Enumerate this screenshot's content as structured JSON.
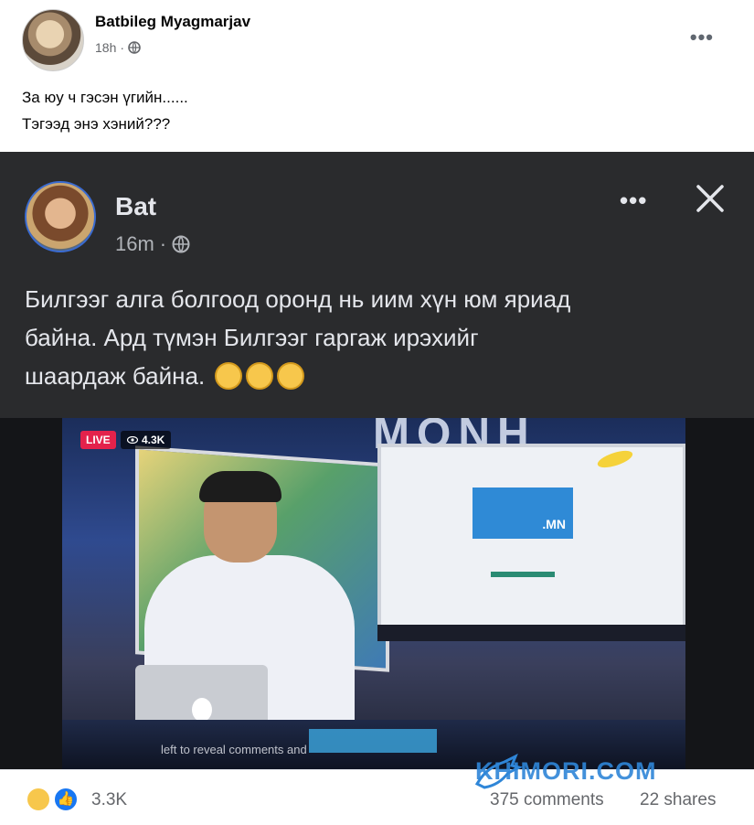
{
  "outer_post": {
    "author": "Batbileg Myagmarjav",
    "time": "18h",
    "privacy_separator": "·",
    "caption_lines": [
      "За юу ч гэсэн үгийн......",
      "Тэгээд энэ хэний???"
    ]
  },
  "shared_post": {
    "author": "Bat",
    "time": "16m",
    "privacy_separator": "·",
    "text_lines": [
      "Билгээг алга болгоод оронд нь иим хүн юм яриад",
      "байна. Ард түмэн Билгээг гаргаж ирэхийг",
      "шаардаж байна."
    ],
    "emoji_count": 3
  },
  "video": {
    "live_label": "LIVE",
    "view_count": "4.3K",
    "overlay_hint": "left to reveal comments and",
    "screen_badge": ".MN",
    "banner_text": "MONH"
  },
  "footer": {
    "reaction_count": "3.3K",
    "comments": "375 comments",
    "shares": "22 shares"
  },
  "watermark": {
    "text": "KHIMORI.COM"
  },
  "colors": {
    "facebook_blue": "#1877f2",
    "dark_post_bg": "#2a2b2d",
    "live_red": "#e4224b",
    "watermark_blue": "#2f86d8"
  }
}
